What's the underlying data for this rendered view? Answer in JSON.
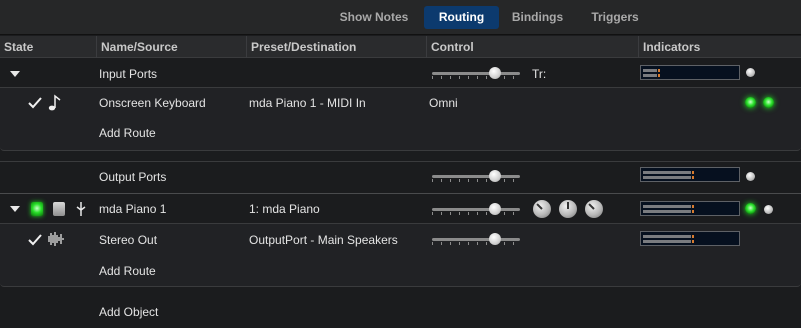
{
  "tabs": [
    {
      "label": "Show Notes",
      "active": false
    },
    {
      "label": "Routing",
      "active": true
    },
    {
      "label": "Bindings",
      "active": false
    },
    {
      "label": "Triggers",
      "active": false
    }
  ],
  "columns": [
    "State",
    "Name/Source",
    "Preset/Destination",
    "Control",
    "Indicators"
  ],
  "rows": {
    "input_ports": {
      "name": "Input Ports",
      "control_text": "Tr:",
      "volume": 0.72
    },
    "onscreen_keyboard": {
      "name": "Onscreen Keyboard",
      "destination": "mda Piano 1 - MIDI In",
      "control_text": "Omni"
    },
    "add_route_1": "Add Route",
    "output_ports": {
      "name": "Output Ports",
      "volume": 0.72
    },
    "mda_piano": {
      "name": "mda Piano 1",
      "destination": "1: mda Piano",
      "volume": 0.72
    },
    "stereo_out": {
      "name": "Stereo Out",
      "destination": "OutputPort - Main Speakers",
      "volume": 0.72
    },
    "add_route_2": "Add Route",
    "add_object": "Add Object"
  },
  "colors": {
    "accent_tab": "#0c3a6e",
    "led_green": "#32e632",
    "meter_peak": "#d77b2f"
  },
  "icons": [
    "disclosure-triangle-icon",
    "checkmark-icon",
    "music-note-icon",
    "waveform-icon",
    "led-indicator-icon",
    "knob-icon",
    "bypass-icon"
  ]
}
